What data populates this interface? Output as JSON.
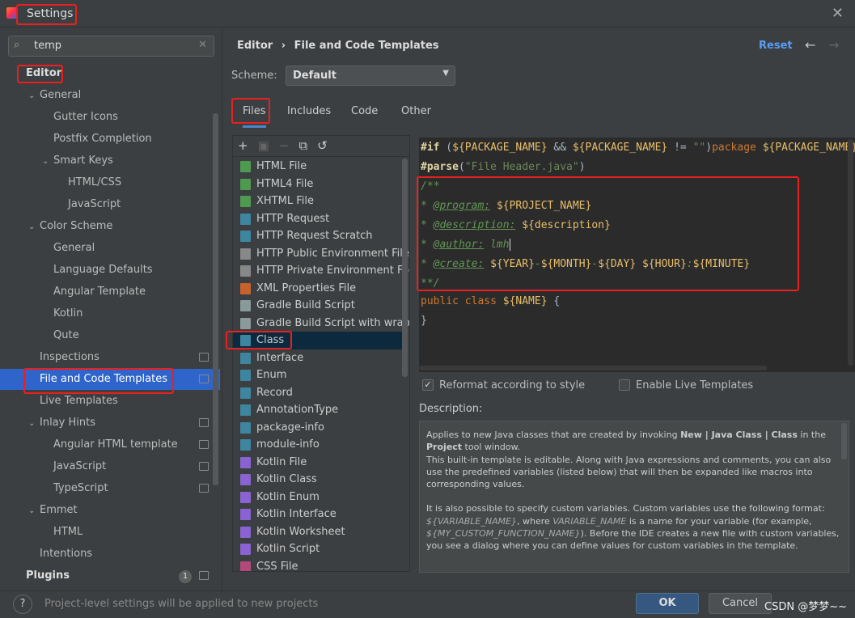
{
  "window": {
    "title": "Settings",
    "close_icon": "close-icon"
  },
  "search": {
    "value": "temp"
  },
  "sidebar": {
    "items": [
      {
        "label": "Editor",
        "level": 0,
        "bold": true
      },
      {
        "label": "General",
        "level": 1,
        "arrow": "down"
      },
      {
        "label": "Gutter Icons",
        "level": 2
      },
      {
        "label": "Postfix Completion",
        "level": 2
      },
      {
        "label": "Smart Keys",
        "level": 2,
        "arrow": "down"
      },
      {
        "label": "HTML/CSS",
        "level": 3
      },
      {
        "label": "JavaScript",
        "level": 3
      },
      {
        "label": "Color Scheme",
        "level": 1,
        "arrow": "down"
      },
      {
        "label": "General",
        "level": 2
      },
      {
        "label": "Language Defaults",
        "level": 2
      },
      {
        "label": "Angular Template",
        "level": 2
      },
      {
        "label": "Kotlin",
        "level": 2
      },
      {
        "label": "Qute",
        "level": 2
      },
      {
        "label": "Inspections",
        "level": 1,
        "badge": true
      },
      {
        "label": "File and Code Templates",
        "level": 1,
        "badge": true,
        "selected": true
      },
      {
        "label": "Live Templates",
        "level": 1
      },
      {
        "label": "Inlay Hints",
        "level": 1,
        "arrow": "down",
        "badge": true
      },
      {
        "label": "Angular HTML template",
        "level": 2,
        "badge": true
      },
      {
        "label": "JavaScript",
        "level": 2,
        "badge": true
      },
      {
        "label": "TypeScript",
        "level": 2,
        "badge": true
      },
      {
        "label": "Emmet",
        "level": 1,
        "arrow": "down"
      },
      {
        "label": "HTML",
        "level": 2
      },
      {
        "label": "Intentions",
        "level": 1
      },
      {
        "label": "Plugins",
        "level": 0,
        "bold": true,
        "count": "1",
        "badge": true
      }
    ]
  },
  "header": {
    "breadcrumb_root": "Editor",
    "breadcrumb_sep": "›",
    "breadcrumb_page": "File and Code Templates",
    "reset": "Reset"
  },
  "scheme": {
    "label": "Scheme:",
    "value": "Default"
  },
  "tabs": [
    "Files",
    "Includes",
    "Code",
    "Other"
  ],
  "templates": [
    {
      "label": "HTML File",
      "color": "#4e9a4e"
    },
    {
      "label": "HTML4 File",
      "color": "#4e9a4e"
    },
    {
      "label": "XHTML File",
      "color": "#4e9a4e"
    },
    {
      "label": "HTTP Request",
      "color": "#3e86a0"
    },
    {
      "label": "HTTP Request Scratch",
      "color": "#3e86a0"
    },
    {
      "label": "HTTP Public Environment File",
      "color": "#888"
    },
    {
      "label": "HTTP Private Environment File",
      "color": "#888"
    },
    {
      "label": "XML Properties File",
      "color": "#c7622d"
    },
    {
      "label": "Gradle Build Script",
      "color": "#8a9a9a"
    },
    {
      "label": "Gradle Build Script with wrapper",
      "color": "#8a9a9a"
    },
    {
      "label": "Class",
      "color": "#3e86a0",
      "selected": true
    },
    {
      "label": "Interface",
      "color": "#3e86a0"
    },
    {
      "label": "Enum",
      "color": "#3e86a0"
    },
    {
      "label": "Record",
      "color": "#3e86a0"
    },
    {
      "label": "AnnotationType",
      "color": "#3e86a0"
    },
    {
      "label": "package-info",
      "color": "#3e86a0"
    },
    {
      "label": "module-info",
      "color": "#3e86a0"
    },
    {
      "label": "Kotlin File",
      "color": "#8a63d2"
    },
    {
      "label": "Kotlin Class",
      "color": "#8a63d2"
    },
    {
      "label": "Kotlin Enum",
      "color": "#8a63d2"
    },
    {
      "label": "Kotlin Interface",
      "color": "#8a63d2"
    },
    {
      "label": "Kotlin Worksheet",
      "color": "#8a63d2"
    },
    {
      "label": "Kotlin Script",
      "color": "#8a63d2"
    },
    {
      "label": "CSS File",
      "color": "#b14a7a"
    }
  ],
  "code": {
    "l1a": "#if",
    "l1b": " (",
    "l1c": "${PACKAGE_NAME}",
    "l1d": " && ",
    "l1e": "${PACKAGE_NAME}",
    "l1f": " != ",
    "l1g": "\"\"",
    "l1h": ")",
    "l1i": "package ",
    "l1j": "${PACKAGE_NAME}",
    "l2a": "#parse",
    "l2b": "(",
    "l2c": "\"File Header.java\"",
    "l2d": ")",
    "l3": "/**",
    "l4a": "* ",
    "l4b": "@program:",
    "l4c": "${PROJECT_NAME}",
    "l5a": "* ",
    "l5b": "@description:",
    "l5c": "${description}",
    "l6a": "* ",
    "l6b": "@author:",
    "l6c": " lmh",
    "l7a": "* ",
    "l7b": "@create:",
    "l7c": "${YEAR}",
    "l7d": "-",
    "l7e": "${MONTH}",
    "l7f": "-",
    "l7g": "${DAY}",
    "l7h": "${HOUR}",
    "l7i": ":",
    "l7j": "${MINUTE}",
    "l8": "**/",
    "l9a": "public class ",
    "l9b": "${NAME}",
    "l9c": " {",
    "l10": "}"
  },
  "options": {
    "reformat": {
      "label": "Reformat according to style",
      "checked": true
    },
    "live": {
      "label": "Enable Live Templates",
      "checked": false
    }
  },
  "description": {
    "label": "Description:",
    "p1a": "Applies to new Java classes that are created by invoking ",
    "p1b": "New | Java Class | Class",
    "p1c": " in the ",
    "p1d": "Project",
    "p1e": " tool window.",
    "p2": "This built-in template is editable. Along with Java expressions and comments, you can also use the predefined variables (listed below) that will then be expanded like macros into corresponding values.",
    "p3a": "It is also possible to specify custom variables. Custom variables use the following format: ",
    "p3b": "${VARIABLE_NAME}",
    "p3c": ", where ",
    "p3d": "VARIABLE_NAME",
    "p3e": " is a name for your variable (for example, ",
    "p3f": "${MY_CUSTOM_FUNCTION_NAME}",
    "p3g": "). Before the IDE creates a new file with custom variables, you see a dialog where you can define values for custom variables in the template."
  },
  "footer": {
    "help": "?",
    "note": "Project-level settings will be applied to new projects",
    "ok": "OK",
    "cancel": "Cancel",
    "watermark": "CSDN @梦梦~~"
  }
}
